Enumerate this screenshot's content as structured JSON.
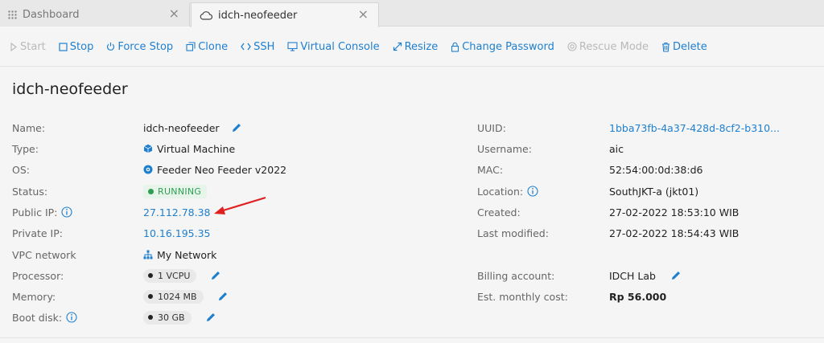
{
  "tabs": [
    {
      "label": "Dashboard",
      "icon": "grid-icon"
    },
    {
      "label": "idch-neofeeder",
      "icon": "cloud-icon"
    }
  ],
  "toolbar": {
    "start": "Start",
    "stop": "Stop",
    "force_stop": "Force Stop",
    "clone": "Clone",
    "ssh": "SSH",
    "virtual_console": "Virtual Console",
    "resize": "Resize",
    "change_password": "Change Password",
    "rescue_mode": "Rescue Mode",
    "delete": "Delete"
  },
  "page_title": "idch-neofeeder",
  "left": {
    "name_label": "Name:",
    "name_value": "idch-neofeeder",
    "type_label": "Type:",
    "type_value": "Virtual Machine",
    "os_label": "OS:",
    "os_value": "Feeder Neo Feeder v2022",
    "status_label": "Status:",
    "status_value": "RUNNING",
    "public_ip_label": "Public IP:",
    "public_ip_value": "27.112.78.38",
    "private_ip_label": "Private IP:",
    "private_ip_value": "10.16.195.35",
    "vpc_label": "VPC network",
    "vpc_value": "My Network",
    "processor_label": "Processor:",
    "processor_value": "1 VCPU",
    "memory_label": "Memory:",
    "memory_value": "1024 MB",
    "boot_disk_label": "Boot disk:",
    "boot_disk_value": "30 GB"
  },
  "right": {
    "uuid_label": "UUID:",
    "uuid_value": "1bba73fb-4a37-428d-8cf2-b310...",
    "username_label": "Username:",
    "username_value": "aic",
    "mac_label": "MAC:",
    "mac_value": "52:54:00:0d:38:d6",
    "location_label": "Location:",
    "location_value": "SouthJKT-a (jkt01)",
    "created_label": "Created:",
    "created_value": "27-02-2022 18:53:10 WIB",
    "modified_label": "Last modified:",
    "modified_value": "27-02-2022 18:54:43 WIB",
    "billing_label": "Billing account:",
    "billing_value": "IDCH Lab",
    "cost_label": "Est. monthly cost:",
    "cost_value": "Rp 56.000"
  },
  "colors": {
    "link": "#1e7fcf",
    "running": "#2f9e52",
    "annotation_arrow": "#e02020"
  }
}
